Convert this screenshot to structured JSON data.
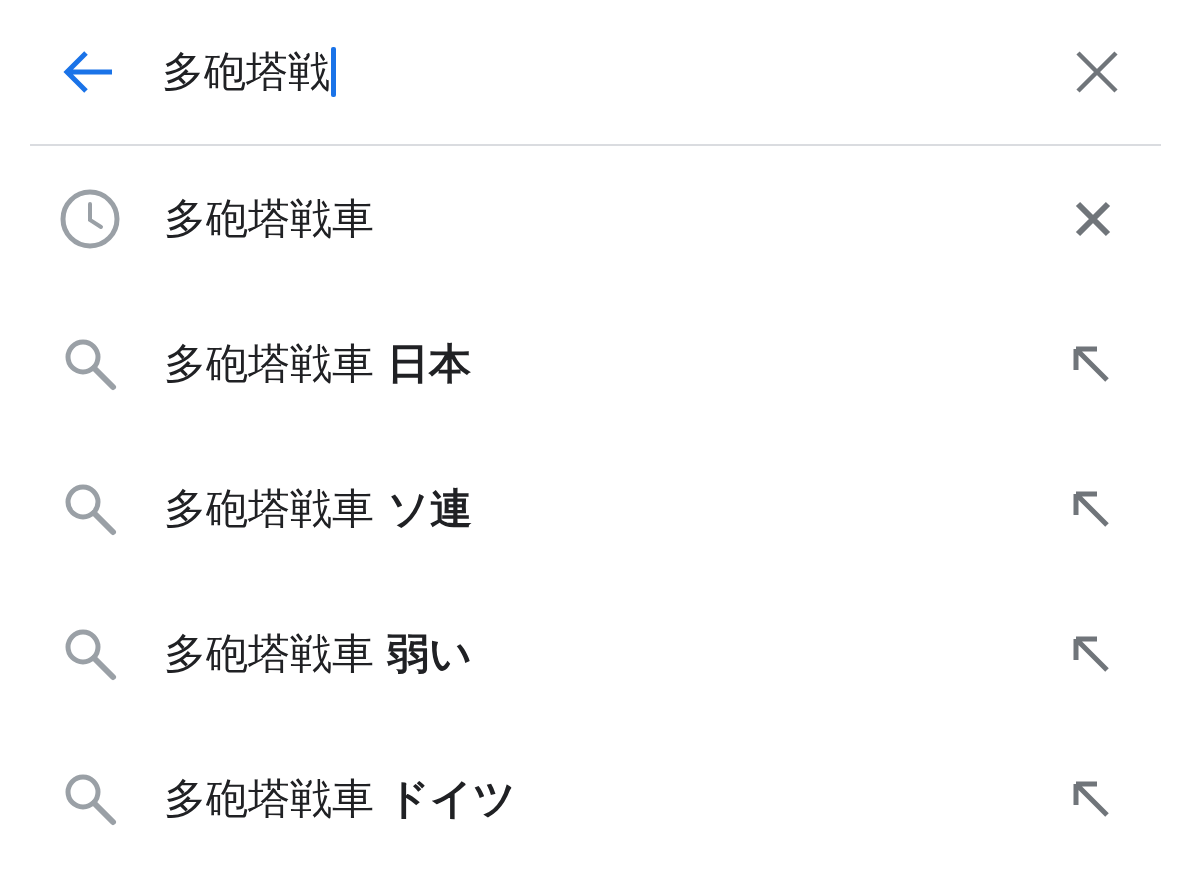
{
  "search": {
    "value": "多砲塔戦"
  },
  "suggestions": [
    {
      "kind": "history",
      "text": "多砲塔戦車"
    },
    {
      "kind": "query",
      "text": "多砲塔戦車 **日本**"
    },
    {
      "kind": "query",
      "text": "多砲塔戦車 **ソ連**"
    },
    {
      "kind": "query",
      "text": "多砲塔戦車 **弱い**"
    },
    {
      "kind": "query",
      "text": "多砲塔戦車 **ドイツ**"
    }
  ]
}
